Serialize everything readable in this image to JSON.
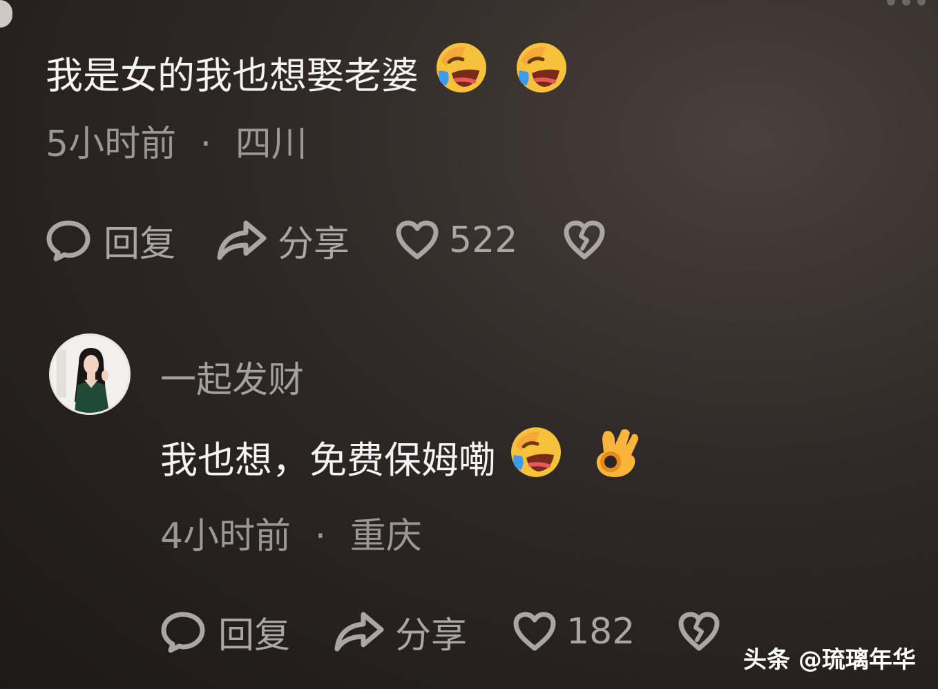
{
  "comment1": {
    "text": "我是女的我也想娶老婆",
    "emojis": [
      "rolling-laughing-emoji",
      "rolling-laughing-emoji"
    ],
    "time": "5小时前",
    "separator": "·",
    "location": "四川",
    "reply_label": "回复",
    "share_label": "分享",
    "like_count": "522"
  },
  "comment2": {
    "username": "一起发财",
    "text": "我也想，免费保姆嘞",
    "emojis": [
      "rolling-laughing-emoji",
      "ok-hand-emoji"
    ],
    "time": "4小时前",
    "separator": "·",
    "location": "重庆",
    "reply_label": "回复",
    "share_label": "分享",
    "like_count": "182"
  },
  "watermark": {
    "text": "头条 @琉璃年华"
  },
  "colors": {
    "background": "#2a2523",
    "text_primary": "#f4f4f4",
    "text_secondary": "#9a9797",
    "emoji_yellow": "#f7c23b",
    "tear_blue": "#3d9be9"
  }
}
